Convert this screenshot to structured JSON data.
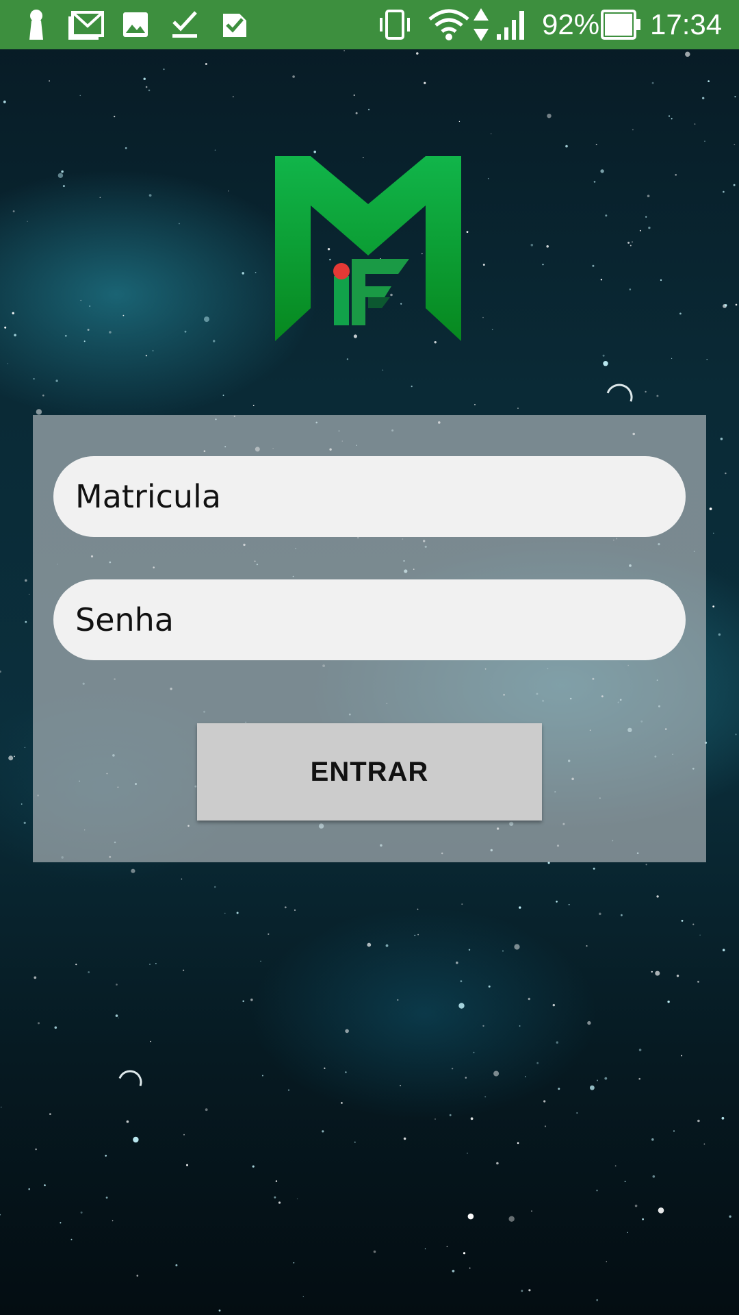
{
  "status_bar": {
    "battery_percent": "92%",
    "time": "17:34",
    "background_color": "#3d8f3e",
    "left_icons": [
      "keyhole-icon",
      "mail-icon",
      "image-icon",
      "check-icon",
      "checklist-icon"
    ],
    "right_icons": [
      "vibrate-icon",
      "wifi-icon",
      "data-arrows-icon",
      "signal-icon",
      "battery-icon"
    ]
  },
  "logo": {
    "name": "mif-logo",
    "colors": {
      "primary": "#0aa03a",
      "dark": "#078a2c",
      "dot": "#e53935"
    }
  },
  "login_form": {
    "matricula_placeholder": "Matricula",
    "matricula_value": "",
    "senha_placeholder": "Senha",
    "senha_value": "",
    "submit_label": "ENTRAR"
  }
}
